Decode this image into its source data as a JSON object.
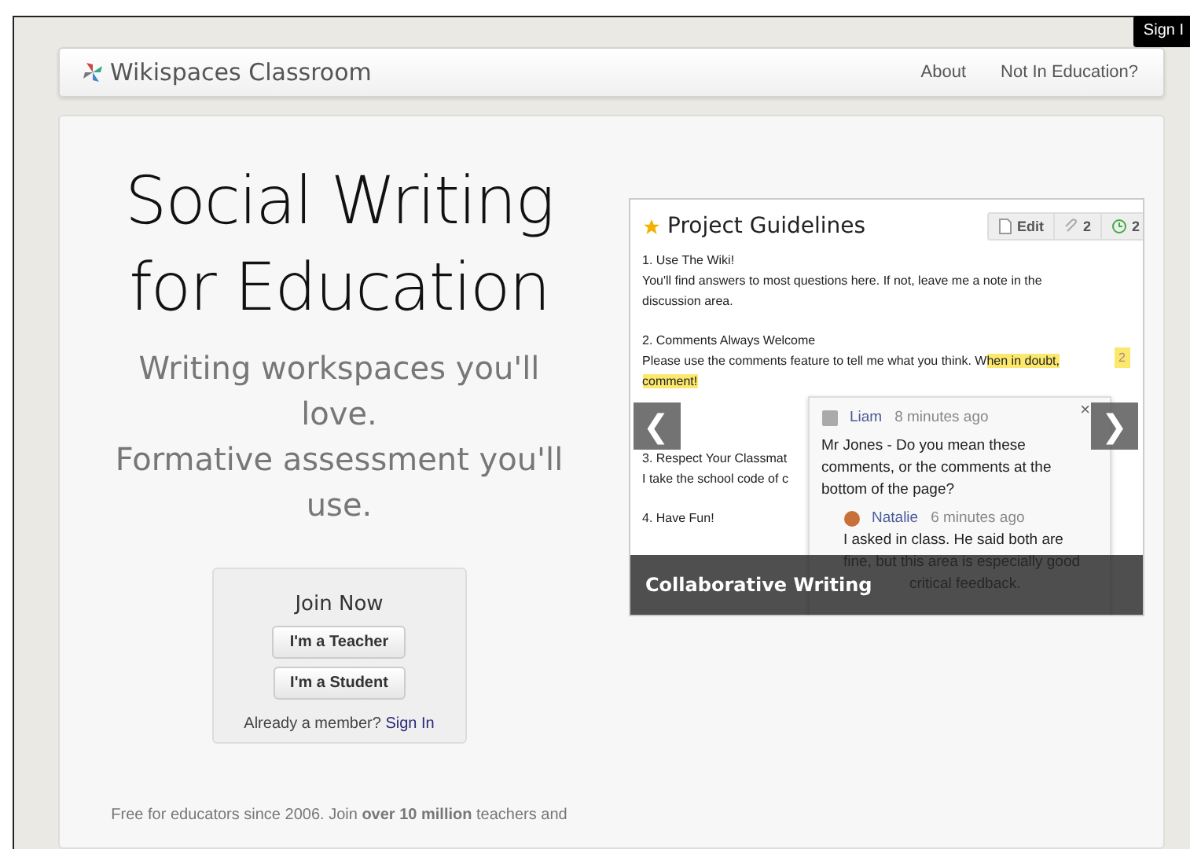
{
  "signin_tab": "Sign I",
  "navbar": {
    "brand": "Wikispaces Classroom",
    "links": [
      "About",
      "Not In Education?"
    ]
  },
  "hero": {
    "title_lines": [
      "Social Writing",
      "for Education"
    ],
    "subtitle_lines": [
      "Writing workspaces you'll",
      "love.",
      "Formative assessment you'll",
      "use."
    ]
  },
  "join": {
    "title": "Join Now",
    "buttons": [
      "I'm a Teacher",
      "I'm a Student"
    ],
    "member_text": "Already a member?",
    "signin_link": "Sign In"
  },
  "footer_text": "Free for educators since 2006. Join **over 10 million** teachers and",
  "slideshow": {
    "caption": "Collaborative Writing",
    "prev": "❮",
    "next": "❯",
    "page": {
      "title": "Project Guidelines",
      "toolbar": [
        {
          "kind": "edit",
          "label": "Edit"
        },
        {
          "kind": "links",
          "label": "2"
        },
        {
          "kind": "history",
          "label": "2"
        }
      ],
      "paragraphs": [
        {
          "heading": "1. Use The Wiki!",
          "lines": [
            "You'll find answers to most questions here. If not, leave me a note in the",
            "discussion area."
          ]
        },
        {
          "heading": "2. Comments Always Welcome",
          "lines": [
            "Please use the comments feature to tell me what you think. W"
          ],
          "highlight": "hen in doubt,",
          "highlight_next": "comment!",
          "badge": "2"
        },
        {
          "heading": "3. Respect Your Classmat",
          "lines": [
            "I take the school code of c"
          ]
        },
        {
          "heading": "4. Have Fun!"
        }
      ]
    },
    "comment": {
      "close": "×",
      "author": "Liam",
      "time": "8 minutes ago",
      "body": "Mr Jones - Do you mean these comments, or the comments at the bottom of the page?",
      "reply": {
        "author": "Natalie",
        "time": "6 minutes ago",
        "lines": [
          "I asked in class. He said both are",
          "fine, but this area is especially good",
          "critical feedback."
        ]
      }
    }
  }
}
